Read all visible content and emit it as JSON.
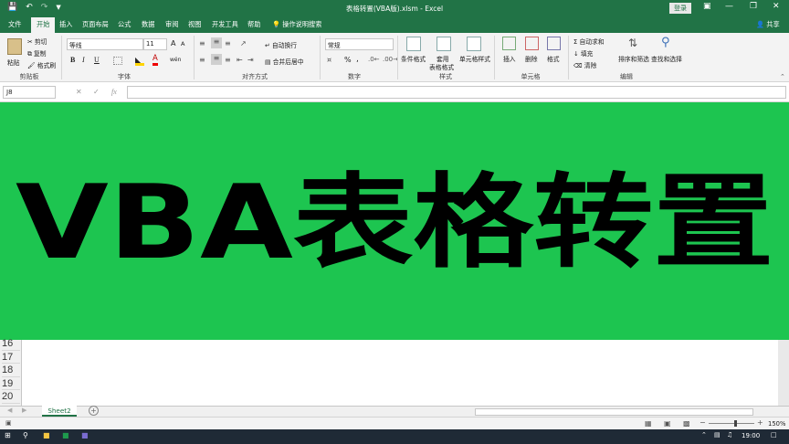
{
  "window": {
    "doc_title": "表格转置(VBA版).xlsm  -  Excel",
    "login_label": "登录"
  },
  "tabs": [
    {
      "label": "文件"
    },
    {
      "label": "开始"
    },
    {
      "label": "插入"
    },
    {
      "label": "页面布局"
    },
    {
      "label": "公式"
    },
    {
      "label": "数据"
    },
    {
      "label": "审阅"
    },
    {
      "label": "视图"
    },
    {
      "label": "开发工具"
    },
    {
      "label": "帮助"
    }
  ],
  "tell_me": "操作说明搜索",
  "share": "共享",
  "ribbon": {
    "clipboard": {
      "paste": "粘贴",
      "cut": "剪切",
      "copy": "复制",
      "format_painter": "格式刷",
      "group": "剪贴板"
    },
    "font": {
      "name": "等线",
      "size": "11",
      "bold": "B",
      "italic": "I",
      "underline": "U",
      "group": "字体",
      "grow": "A",
      "shrink": "A",
      "color_a": "A",
      "phonetic": "wén"
    },
    "alignment": {
      "wrap": "自动换行",
      "merge": "合并后居中",
      "group": "对齐方式"
    },
    "number": {
      "format": "常规",
      "percent": "%",
      "comma": ",",
      "group": "数字"
    },
    "styles": {
      "conditional": "条件格式",
      "table_1": "套用",
      "table_2": "表格格式",
      "cell_styles": "单元格样式",
      "group": "样式"
    },
    "cells": {
      "insert": "插入",
      "delete": "删除",
      "format": "格式",
      "group": "单元格"
    },
    "editing": {
      "autosum": "自动求和",
      "fill": "填充",
      "clear": "清除",
      "sort": "排序和筛选",
      "find": "查找和选择",
      "group": "编辑"
    }
  },
  "formula_bar": {
    "name_box": "J8",
    "fx": "fx",
    "value": ""
  },
  "banner": {
    "text": "VBA表格转置",
    "bg": "#1dc550"
  },
  "rows": [
    "16",
    "17",
    "18",
    "19",
    "20"
  ],
  "sheet": {
    "tab": "Sheet2",
    "add": "+"
  },
  "status": {
    "zoom": "150%"
  },
  "taskbar": {
    "time": "19:00"
  },
  "colors": {
    "excel_green": "#217346",
    "banner_green": "#1dc550"
  }
}
